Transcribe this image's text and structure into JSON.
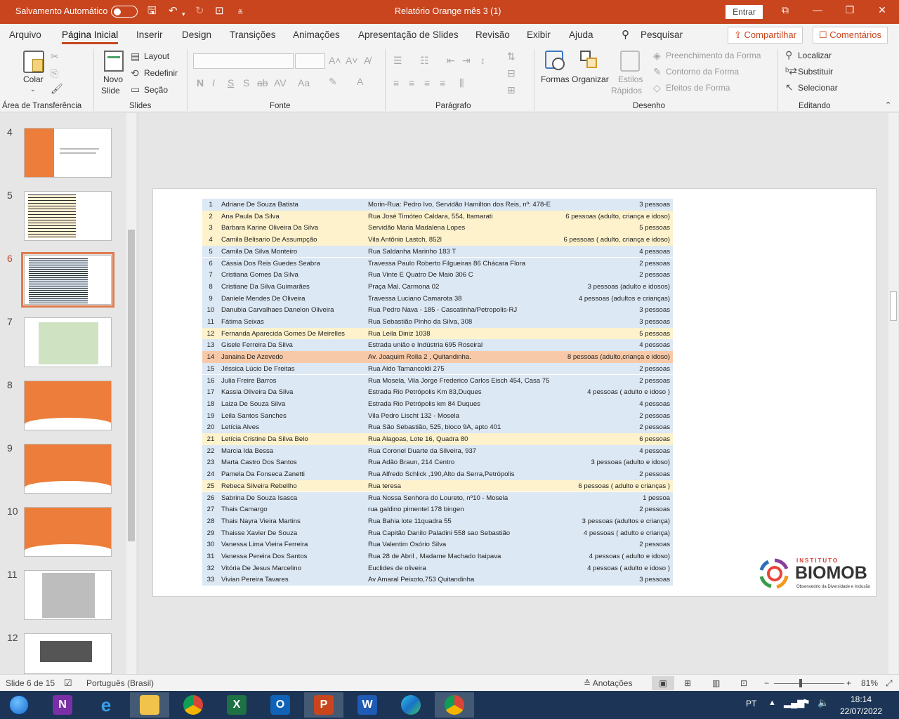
{
  "titlebar": {
    "autosave_label": "Salvamento Automático",
    "doc_title": "Relatório Orange mês  3 (1)",
    "signin_label": "Entrar"
  },
  "menu": {
    "tabs": [
      "Arquivo",
      "Página Inicial",
      "Inserir",
      "Design",
      "Transições",
      "Animações",
      "Apresentação de Slides",
      "Revisão",
      "Exibir",
      "Ajuda"
    ],
    "search_label": "Pesquisar",
    "share_label": "Compartilhar",
    "comments_label": "Comentários"
  },
  "ribbon": {
    "paste_label": "Colar",
    "new_slide_label1": "Novo",
    "new_slide_label2": "Slide",
    "layout_label": "Layout",
    "reset_label": "Redefinir",
    "section_label": "Seção",
    "shapes_label": "Formas",
    "arrange_label": "Organizar",
    "quick_styles_label1": "Estilos",
    "quick_styles_label2": "Rápidos",
    "shape_fill_label": "Preenchimento da Forma",
    "shape_outline_label": "Contorno da Forma",
    "shape_effects_label": "Efeitos de Forma",
    "find_label": "Localizar",
    "replace_label": "Substituir",
    "select_label": "Selecionar",
    "groups": {
      "clipboard": "Área de Transferência",
      "slides": "Slides",
      "font": "Fonte",
      "paragraph": "Parágrafo",
      "drawing": "Desenho",
      "editing": "Editando"
    }
  },
  "thumbnails": [
    "4",
    "5",
    "6",
    "7",
    "8",
    "9",
    "10",
    "11",
    "12"
  ],
  "selected_slide": "6",
  "table": [
    {
      "n": "1",
      "name": "Adriane De Souza Batista",
      "addr": "Morin-Rua: Pedro Ivo, Servidão Hamilton dos Reis, nº: 478-E",
      "ppl": "3 pessoas",
      "hl": "b"
    },
    {
      "n": "2",
      "name": "Ana Paula Da Silva",
      "addr": "Rua José Timóteo Caldara, 554, Itamarati",
      "ppl": "6 pessoas (adulto, criança e  idoso)",
      "hl": "y"
    },
    {
      "n": "3",
      "name": "Bárbara Karine Oliveira Da Silva",
      "addr": "Servidão Maria Madalena Lopes",
      "ppl": "5 pessoas",
      "hl": "y"
    },
    {
      "n": "4",
      "name": "Camila Belisario De Assumpção",
      "addr": "Vila Antônio Lastch, 852l",
      "ppl": "6 pessoas ( adulto, criança e idoso)",
      "hl": "y"
    },
    {
      "n": "5",
      "name": "Camila Da Silva Monteiro",
      "addr": "Rua Saldanha Marinho 183 T",
      "ppl": "4 pessoas",
      "hl": "b"
    },
    {
      "n": "6",
      "name": "Cássia Dos Reis  Guedes Seabra",
      "addr": "Travessa Paulo Roberto Filgueiras 86 Chácara Flora",
      "ppl": "2 pessoas",
      "hl": "b"
    },
    {
      "n": "7",
      "name": "Cristiana Gomes Da Silva",
      "addr": "Rua Vinte E Quatro De Maio 306 C",
      "ppl": "2 pessoas",
      "hl": "b"
    },
    {
      "n": "8",
      "name": "Cristiane Da Silva Guimarães",
      "addr": "Praça Mal. Carmona 02",
      "ppl": "3 pessoas (adulto  e  idosos)",
      "hl": "b"
    },
    {
      "n": "9",
      "name": "Daniele Mendes De Oliveira",
      "addr": "Travessa Luciano Camarota 38",
      "ppl": "4 pessoas (adultos e crianças)",
      "hl": "b"
    },
    {
      "n": "10",
      "name": "Danubia Carvalhaes Danelon Oliveira",
      "addr": "Rua Pedro Nava - 185 - Cascatinha/Petropolis-RJ",
      "ppl": "3 pessoas",
      "hl": "b"
    },
    {
      "n": "11",
      "name": "Fátima Seixas",
      "addr": "Rua Sebastião Pinho da Silva, 308",
      "ppl": "3 pessoas",
      "hl": "b"
    },
    {
      "n": "12",
      "name": "Fernanda Aparecida Gomes De Meirelles",
      "addr": "Rua Leila Diniz 1038",
      "ppl": "5 pessoas",
      "hl": "y"
    },
    {
      "n": "13",
      "name": "Gisele Ferreira Da Silva",
      "addr": "Estrada união e Indústria 695 Roseiral",
      "ppl": "4 pessoas",
      "hl": "b"
    },
    {
      "n": "14",
      "name": "Janaina De Azevedo",
      "addr": "Av. Joaquim Rolla 2 , Quitandinha.",
      "ppl": "8 pessoas (adulto,criança e idoso)",
      "hl": "o"
    },
    {
      "n": "15",
      "name": "Jéssica Lúcio De Freitas",
      "addr": "Rua Aldo Tamancoldi 275",
      "ppl": "2 pessoas",
      "hl": "b"
    },
    {
      "n": "16",
      "name": "Julia Freire Barros",
      "addr": "Rua Mosela, Vila Jorge Frederico Carlos Eisch 454, Casa 75",
      "ppl": "2 pessoas",
      "hl": "b"
    },
    {
      "n": "17",
      "name": "Kassia Oliveira Da Silva",
      "addr": "Estrada Rio Petrópolis Km 83,Duques",
      "ppl": "4 pessoas ( adulto e idoso )",
      "hl": "b"
    },
    {
      "n": "18",
      "name": "Laiza De Souza Silva",
      "addr": "Estrada Rio Petrópolis km 84 Duques",
      "ppl": "4 pessoas",
      "hl": "b"
    },
    {
      "n": "19",
      "name": "Leila Santos Sanches",
      "addr": "Vila Pedro Lischt 132 - Mosela",
      "ppl": "2 pessoas",
      "hl": "b"
    },
    {
      "n": "20",
      "name": "Letícia Alves",
      "addr": "Rua São Sebastião, 525, bloco 9A, apto 401",
      "ppl": "2 pessoas",
      "hl": "b"
    },
    {
      "n": "21",
      "name": "Letícia Cristine Da Silva Belo",
      "addr": "Rua Alagoas, Lote 16, Quadra 80",
      "ppl": "6  pessoas",
      "hl": "y"
    },
    {
      "n": "22",
      "name": "Marcia Ida Bessa",
      "addr": "Rua Coronel Duarte da Silveira, 937",
      "ppl": "4 pessoas",
      "hl": "b"
    },
    {
      "n": "23",
      "name": "Marta Castro Dos Santos",
      "addr": "Rua Adão Braun, 214 Centro",
      "ppl": "3 pessoas   (adulto e idoso)",
      "hl": "b"
    },
    {
      "n": "24",
      "name": "Pamela Da Fonseca Zanetti",
      "addr": "Rua Alfredo Schlick ,190,Alto da Serra,Petrópolis",
      "ppl": "2 pessoas",
      "hl": "b"
    },
    {
      "n": "25",
      "name": "Rebeca Silveira Rebellho",
      "addr": "Rua teresa",
      "ppl": "6  pessoas  ( adulto e crianças )",
      "hl": "y"
    },
    {
      "n": "26",
      "name": "Sabrina De Souza Isasca",
      "addr": "Rua Nossa Senhora do Loureto, nº10 - Mosela",
      "ppl": "1 pessoa",
      "hl": "b"
    },
    {
      "n": "27",
      "name": "Thais Camargo",
      "addr": "rua galdino pimentel 178 bingen",
      "ppl": "2 pessoas",
      "hl": "b"
    },
    {
      "n": "28",
      "name": "Thais Nayra Vieira Martins",
      "addr": "Rua Bahia lote 11quadra 55",
      "ppl": "3 pessoas (adultos e criança)",
      "hl": "b"
    },
    {
      "n": "29",
      "name": "Thaisse Xavier De Souza",
      "addr": "Rua Capitão Danilo Paladini 558 sao Sebastião",
      "ppl": "4 pessoas  ( adulto e criança)",
      "hl": "b"
    },
    {
      "n": "30",
      "name": "Vanessa Lima Vieira Ferreira",
      "addr": "Rua Valentim Osório Silva",
      "ppl": "2 pessoas",
      "hl": "b"
    },
    {
      "n": "31",
      "name": "Vanessa Pereira Dos Santos",
      "addr": "Rua 28 de Abril , Madame Machado Itaipava",
      "ppl": "4 pessoas  ( adulto e idoso)",
      "hl": "b"
    },
    {
      "n": "32",
      "name": "Vitória De Jesus Marcelino",
      "addr": "Euclides de oliveira",
      "ppl": "4 pessoas ( adulto e idoso )",
      "hl": "b"
    },
    {
      "n": "33",
      "name": "Vivian Pereira Tavares",
      "addr": "Av Amaral Peixoto,753 Quitandinha",
      "ppl": "3 pessoas",
      "hl": "b"
    }
  ],
  "logo": {
    "top": "INSTITUTO",
    "main": "BIOMOB",
    "sub": "Observatório da Diversidade e Inclusão"
  },
  "status": {
    "slide_info": "Slide 6 de 15",
    "language": "Português (Brasil)",
    "notes_label": "Anotações",
    "zoom": "81%"
  },
  "taskbar": {
    "lang": "PT",
    "time": "18:14",
    "date": "22/07/2022"
  },
  "colors": {
    "accent": "#c8451e",
    "row_blue": "#dce8f4",
    "row_yellow": "#fef2cc",
    "row_orange": "#f8c9a8",
    "taskbar": "#1c3556"
  }
}
